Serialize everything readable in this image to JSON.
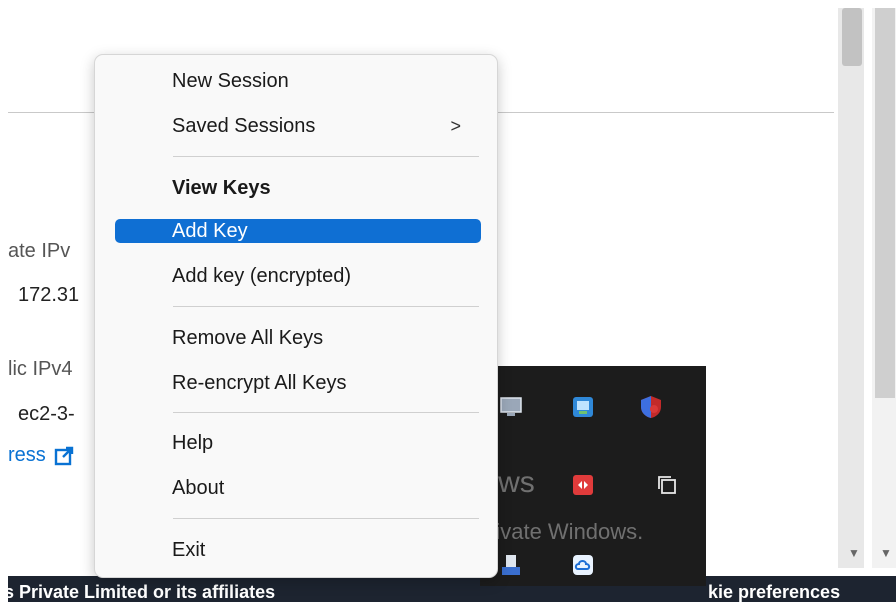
{
  "background": {
    "line1": "ate IPv",
    "value1": "172.31",
    "line2": "lic IPv4",
    "value2": "ec2-3-",
    "link": "ress"
  },
  "footer": {
    "left_text": "s Private Limited or its affiliates",
    "right_text": "kie preferences"
  },
  "context_menu": {
    "items": [
      {
        "label": "New Session"
      },
      {
        "label": "Saved Sessions",
        "submenu_arrow": ">"
      },
      {
        "label": "View Keys"
      },
      {
        "label": "Add Key"
      },
      {
        "label": "Add key (encrypted)"
      },
      {
        "label": "Remove All Keys"
      },
      {
        "label": "Re-encrypt All Keys"
      },
      {
        "label": "Help"
      },
      {
        "label": "About"
      },
      {
        "label": "Exit"
      }
    ],
    "highlighted_item": "Add Key"
  },
  "tray": {
    "icons": [
      "monitor-icon",
      "network-icon",
      "shield-icon",
      "red-app-icon",
      "copy-icon",
      "usb-icon",
      "cloud-icon"
    ]
  },
  "watermark": {
    "title": "Activate Windows",
    "subtitle": "Go to Settings to activate Windows."
  },
  "colors": {
    "highlight": "#0f6fd3",
    "footer": "#1d2430",
    "tray": "#1c1c1c",
    "link": "#0972d3"
  }
}
